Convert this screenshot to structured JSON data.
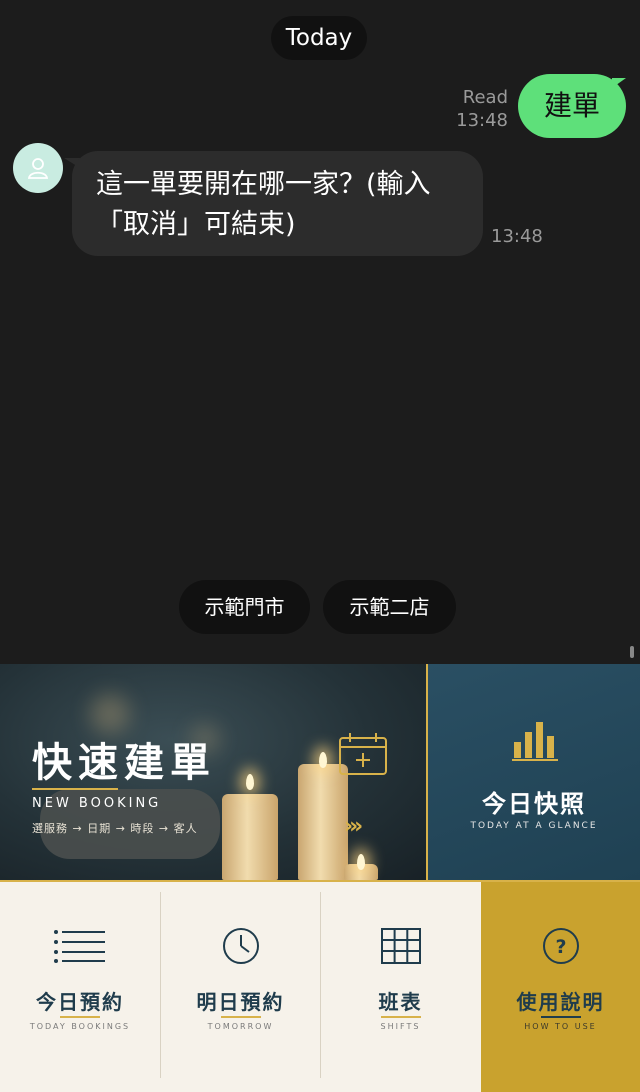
{
  "chat": {
    "date_divider": "Today",
    "outgoing": {
      "read_label": "Read",
      "time": "13:48",
      "text": "建單"
    },
    "incoming": {
      "text": "這一單要開在哪一家？(輸入「取消」可結束)",
      "time": "13:48"
    },
    "quick_replies": [
      "示範門市",
      "示範二店"
    ]
  },
  "rich_menu": {
    "new_booking": {
      "title": "快速建單",
      "subtitle": "NEW BOOKING",
      "steps": "選服務 → 日期 → 時段 → 客人",
      "arrows": "›››"
    },
    "today_glance": {
      "title": "今日快照",
      "subtitle": "TODAY AT A GLANCE"
    },
    "tiles": [
      {
        "title": "今日預約",
        "subtitle": "TODAY BOOKINGS",
        "icon": "list-icon"
      },
      {
        "title": "明日預約",
        "subtitle": "TOMORROW",
        "icon": "clock-icon"
      },
      {
        "title": "班表",
        "subtitle": "SHIFTS",
        "icon": "grid-icon"
      },
      {
        "title": "使用說明",
        "subtitle": "HOW TO USE",
        "icon": "help-icon"
      }
    ],
    "colors": {
      "gold": "#d8b24a",
      "navy": "#1f3c4c",
      "teal": "#2a4f63",
      "cream": "#f6f2ea",
      "help_bg": "#c9a22e",
      "bubble_green": "#5ee07a"
    }
  }
}
